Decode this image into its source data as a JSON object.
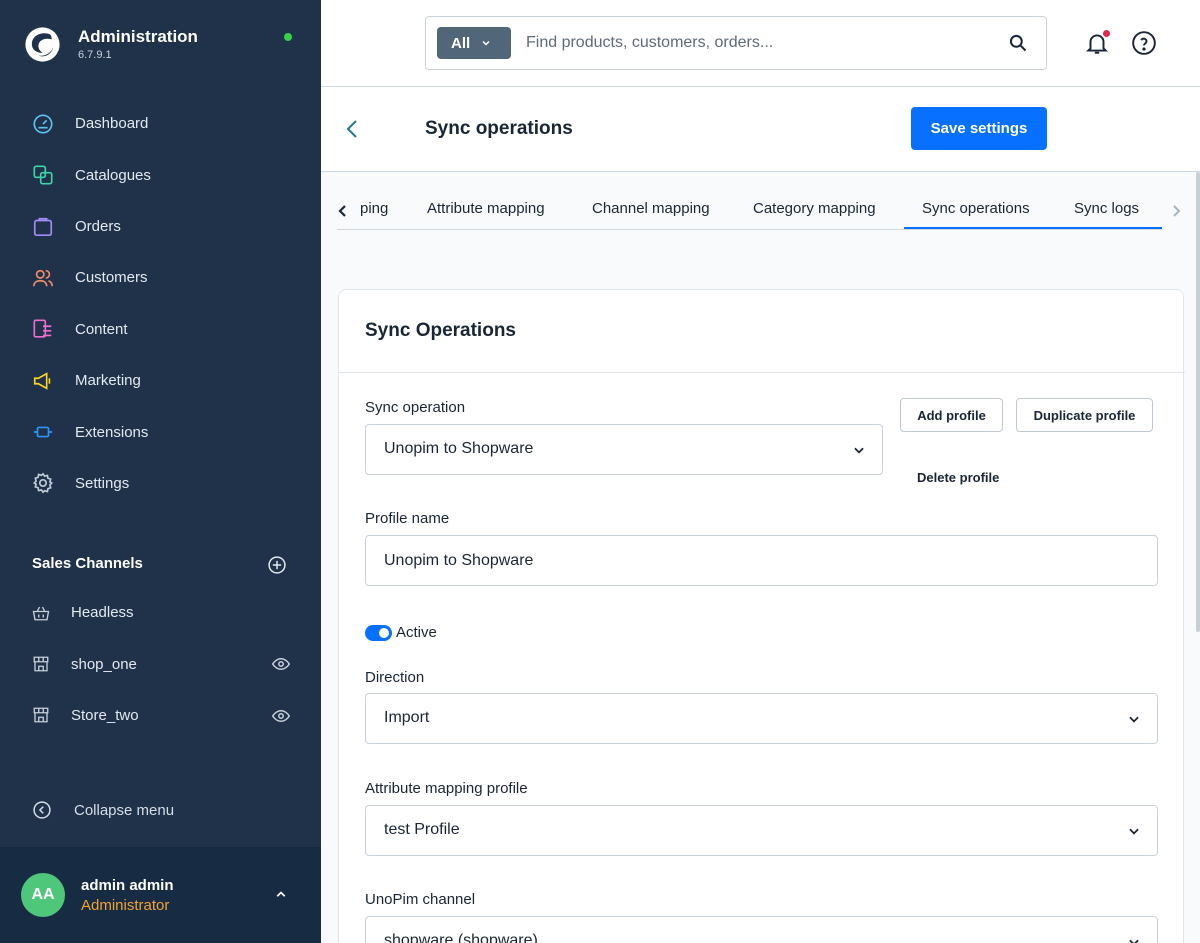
{
  "app": {
    "title": "Administration",
    "version": "6.7.9.1"
  },
  "nav": {
    "items": [
      {
        "label": "Dashboard",
        "icon": "dashboard-gauge-icon",
        "color": "#5ec2f0"
      },
      {
        "label": "Catalogues",
        "icon": "catalogue-icon",
        "color": "#3fd3a8"
      },
      {
        "label": "Orders",
        "icon": "shopping-bag-icon",
        "color": "#a38cf6"
      },
      {
        "label": "Customers",
        "icon": "users-icon",
        "color": "#f58b68"
      },
      {
        "label": "Content",
        "icon": "content-icon",
        "color": "#ec6fcf"
      },
      {
        "label": "Marketing",
        "icon": "megaphone-icon",
        "color": "#ffd21f"
      },
      {
        "label": "Extensions",
        "icon": "plug-icon",
        "color": "#2c95ff"
      },
      {
        "label": "Settings",
        "icon": "gear-icon",
        "color": "#c2ccd6"
      }
    ]
  },
  "sales_channels": {
    "title": "Sales Channels",
    "items": [
      {
        "label": "Headless",
        "icon": "basket-icon",
        "has_eye": false
      },
      {
        "label": "shop_one",
        "icon": "storefront-icon",
        "has_eye": true
      },
      {
        "label": "Store_two",
        "icon": "storefront-icon",
        "has_eye": true
      }
    ]
  },
  "collapse_label": "Collapse menu",
  "user": {
    "initials": "AA",
    "name": "admin admin",
    "role": "Administrator"
  },
  "search": {
    "type": "All",
    "placeholder": "Find products, customers, orders..."
  },
  "smartbar": {
    "title": "Sync operations",
    "save_label": "Save settings"
  },
  "tabs": [
    {
      "label": "ping",
      "active": false
    },
    {
      "label": "Attribute mapping",
      "active": false
    },
    {
      "label": "Channel mapping",
      "active": false
    },
    {
      "label": "Category mapping",
      "active": false
    },
    {
      "label": "Sync operations",
      "active": true
    },
    {
      "label": "Sync logs",
      "active": true
    }
  ],
  "card": {
    "title": "Sync Operations",
    "sync_operation": {
      "label": "Sync operation",
      "value": "Unopim to Shopware"
    },
    "buttons": {
      "add": "Add profile",
      "duplicate": "Duplicate profile",
      "delete": "Delete profile"
    },
    "profile_name": {
      "label": "Profile name",
      "value": "Unopim to Shopware"
    },
    "active": {
      "label": "Active",
      "on": true
    },
    "direction": {
      "label": "Direction",
      "value": "Import"
    },
    "attribute_mapping_profile": {
      "label": "Attribute mapping profile",
      "value": "test Profile"
    },
    "unopim_channel": {
      "label": "UnoPim channel",
      "value": "shopware (shopware)"
    }
  },
  "colors": {
    "sidebar": "#1f3249",
    "accent": "#0870ff",
    "role": "#f0a431",
    "online": "#37d046",
    "notification": "#de294c"
  }
}
